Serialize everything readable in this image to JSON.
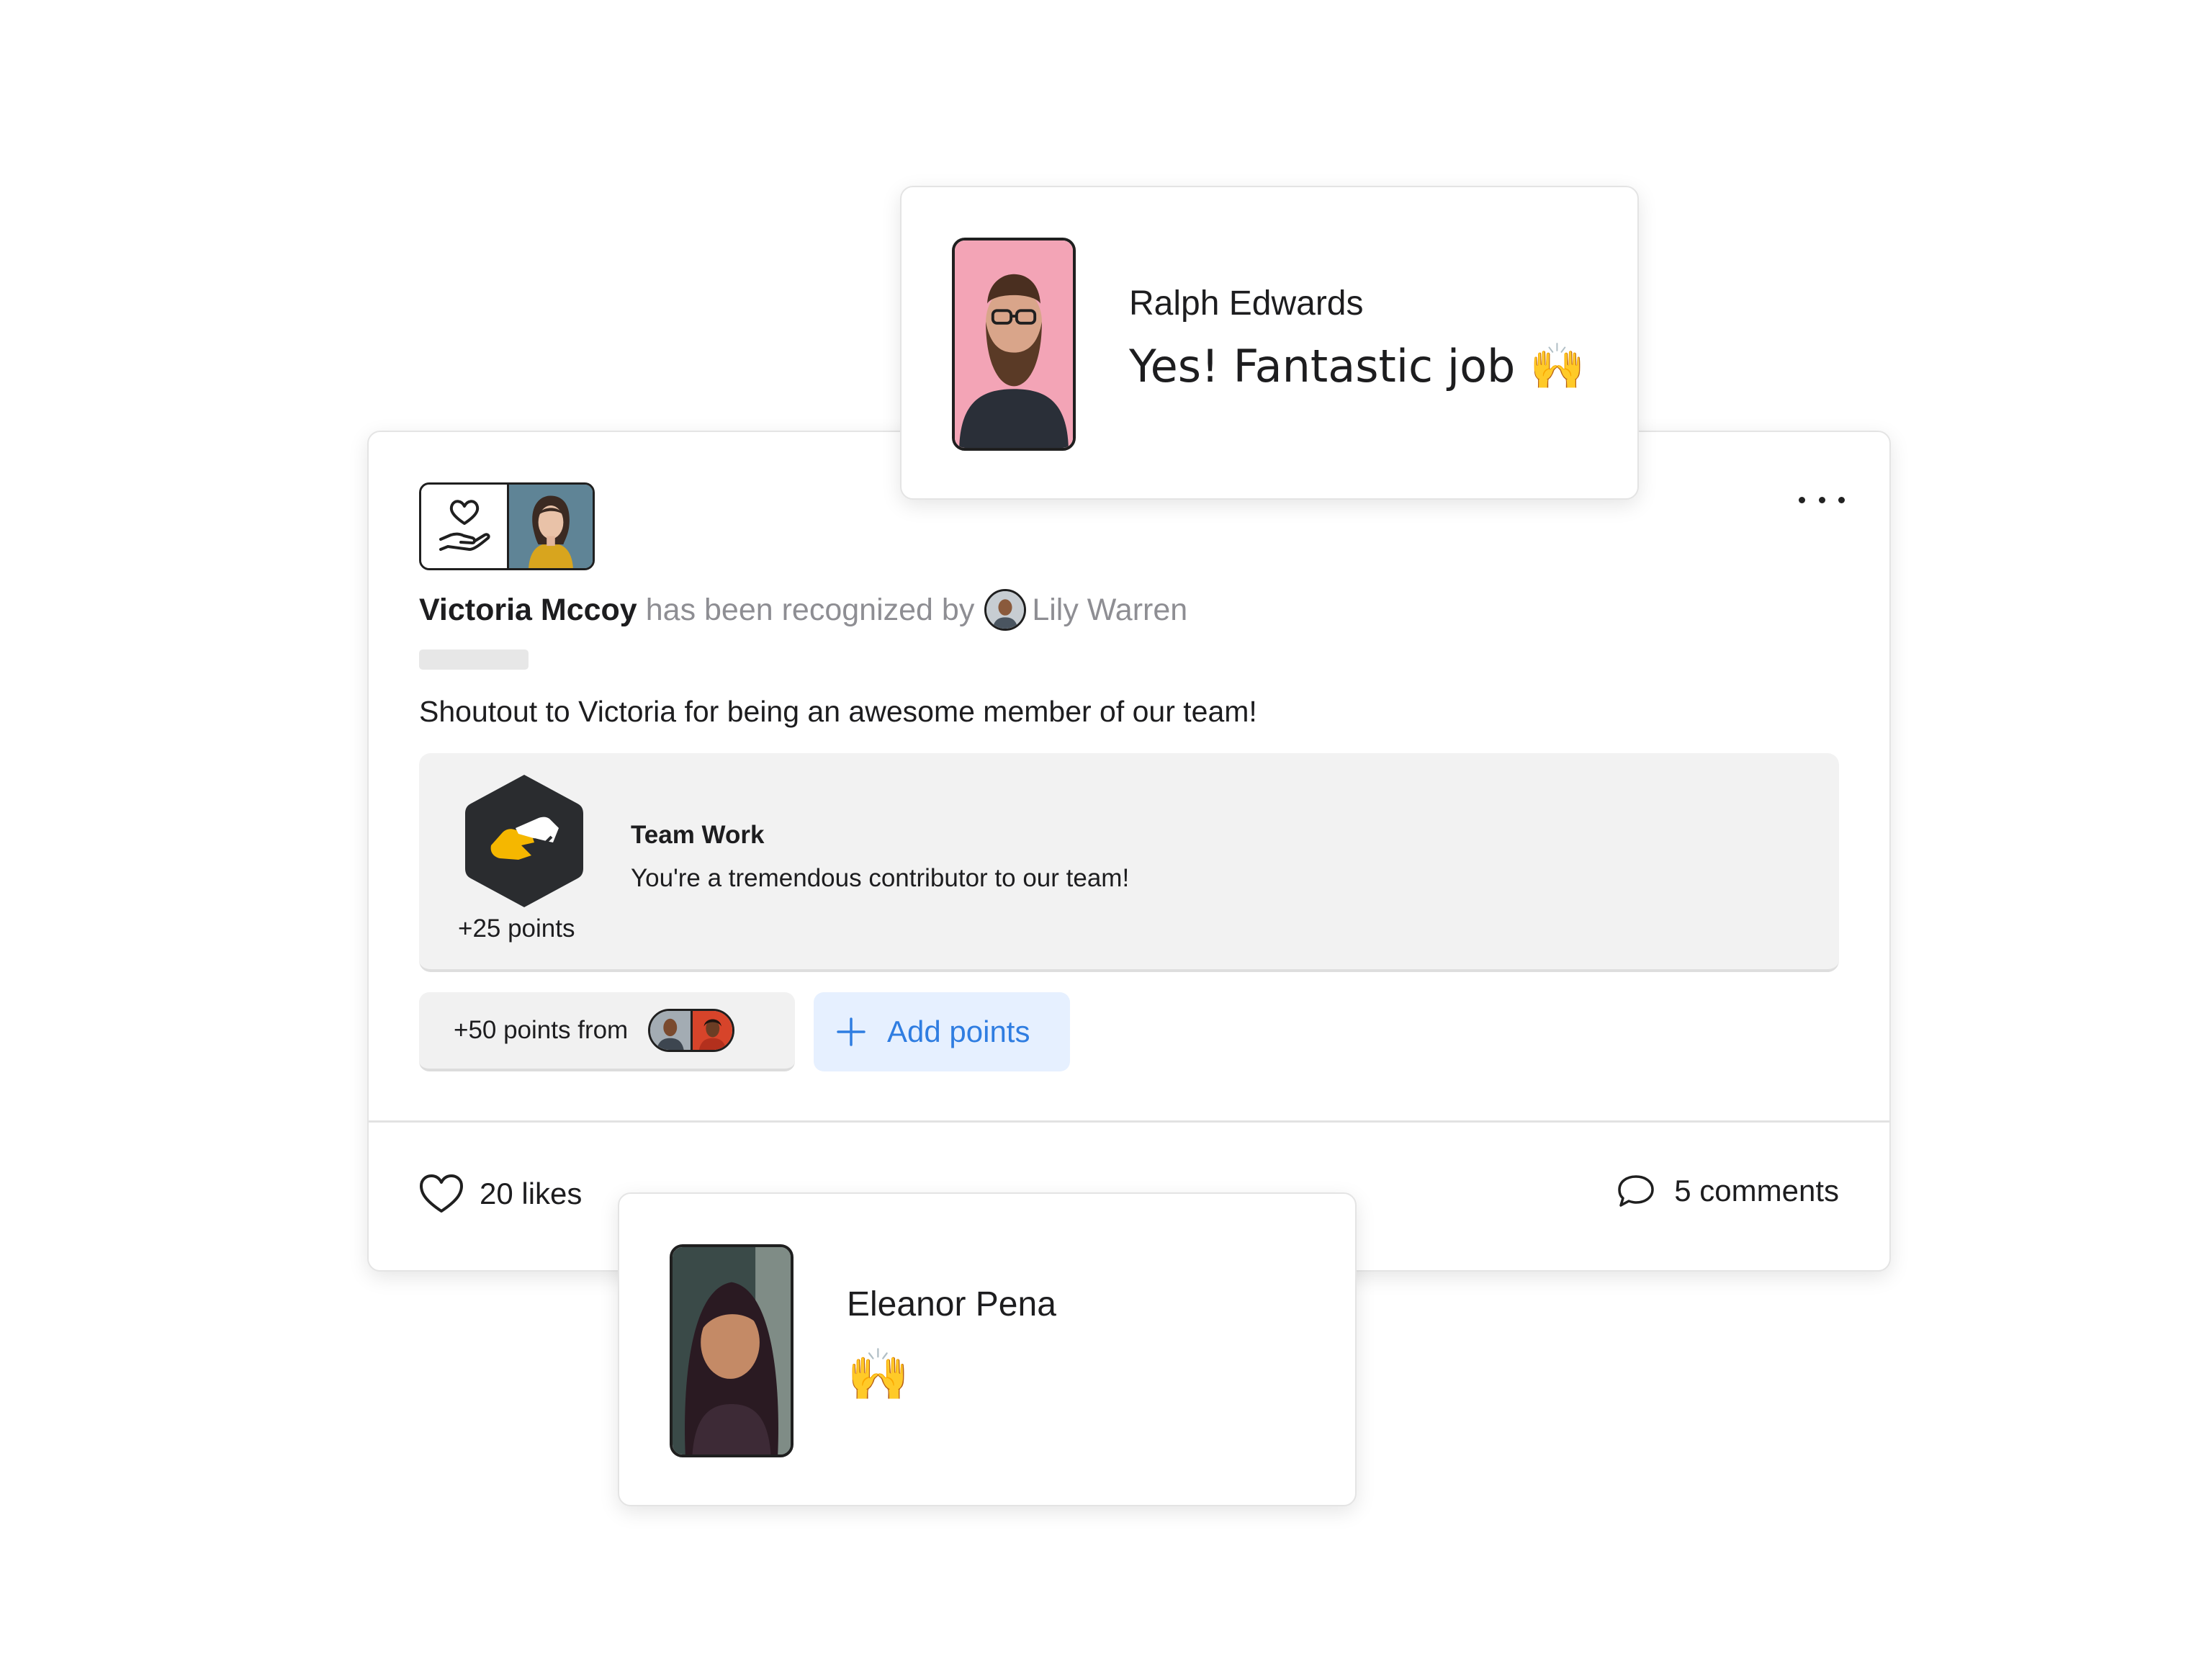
{
  "post": {
    "recipient_name": "Victoria Mccoy",
    "recognized_text": "has been recognized by",
    "sender_name": "Lily Warren",
    "message": "Shoutout to Victoria for being an awesome member of our team!",
    "award": {
      "title": "Team Work",
      "description": "You're a tremendous contributor to our team!",
      "points": "+25 points"
    },
    "extra_points_label": "+50 points from",
    "add_points_label": "Add points",
    "likes_label": "20 likes",
    "comments_label": "5 comments"
  },
  "comments": [
    {
      "author": "Ralph Edwards",
      "text": "Yes! Fantastic job 🙌"
    },
    {
      "author": "Eleanor Pena",
      "text": "🙌"
    }
  ],
  "colors": {
    "accent_blue": "#2f7de1",
    "add_points_bg": "#e6f0ff",
    "award_hex": "#2a2c2f",
    "award_hand": "#f5b700",
    "muted_text": "#8e8e93"
  },
  "icons": [
    "heart-hand-icon",
    "more-icon",
    "plus-icon",
    "heart-icon",
    "comment-icon",
    "team-work-badge-icon"
  ]
}
